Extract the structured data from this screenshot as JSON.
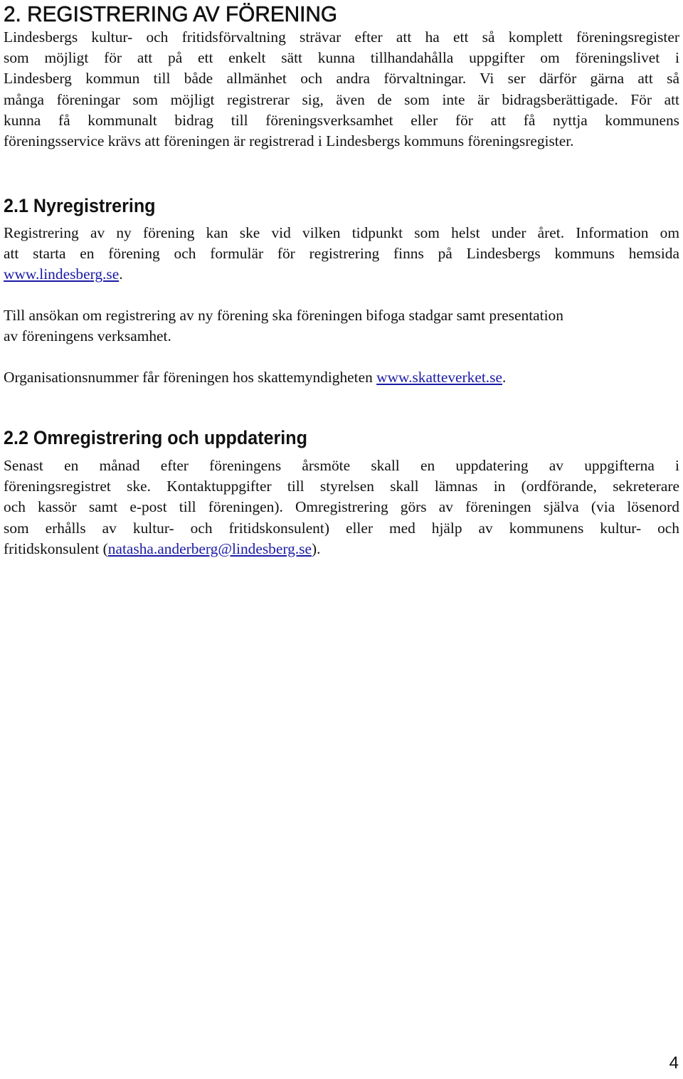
{
  "document": {
    "section_title": "2. REGISTRERING AV FÖRENING",
    "intro_lines": [
      "Lindesbergs kultur- och fritidsförvaltning strävar efter att ha ett så komplett föreningsregister",
      "som möjligt för att på ett enkelt sätt kunna tillhandahålla uppgifter om föreningslivet i",
      "Lindesberg kommun till både allmänhet och andra förvaltningar. Vi ser därför gärna att så",
      "många föreningar som möjligt registrerar sig, även de som inte är bidragsberättigade. För att",
      "kunna få kommunalt bidrag till föreningsverksamhet eller för att få nyttja kommunens",
      "föreningsservice krävs att föreningen är registrerad i Lindesbergs kommuns föreningsregister."
    ],
    "subsection_1": {
      "title": "2.1 Nyregistrering",
      "p1_lines": [
        "Registrering av ny förening kan ske vid vilken tidpunkt som helst under året. Information om",
        "att starta en förening och formulär för registrering finns på Lindesbergs kommuns hemsida"
      ],
      "p1_link": "www.lindesberg.se",
      "p1_end": ".",
      "p2_lines": [
        "Till ansökan om registrering av ny förening ska föreningen bifoga stadgar samt presentation",
        "av föreningens verksamhet."
      ],
      "p3_text": "Organisationsnummer får föreningen hos skattemyndigheten ",
      "p3_link": "www.skatteverket.se",
      "p3_end": "."
    },
    "subsection_2": {
      "title": "2.2 Omregistrering och uppdatering",
      "lines": [
        "Senast en månad efter föreningens årsmöte skall en uppdatering av uppgifterna i",
        "föreningsregistret ske. Kontaktuppgifter till styrelsen skall lämnas in (ordförande, sekreterare",
        "och kassör samt e-post till föreningen). Omregistrering görs av föreningen själva (via lösenord",
        "som erhålls av kultur- och fritidskonsulent) eller med hjälp av kommunens kultur- och"
      ],
      "last_line_start": "fritidskonsulent (",
      "email_link": "natasha.anderberg@lindesberg.se",
      "last_line_end": ")."
    },
    "page_number": "4",
    "colors": {
      "link": "#1a1aa6",
      "text": "#111111"
    }
  }
}
